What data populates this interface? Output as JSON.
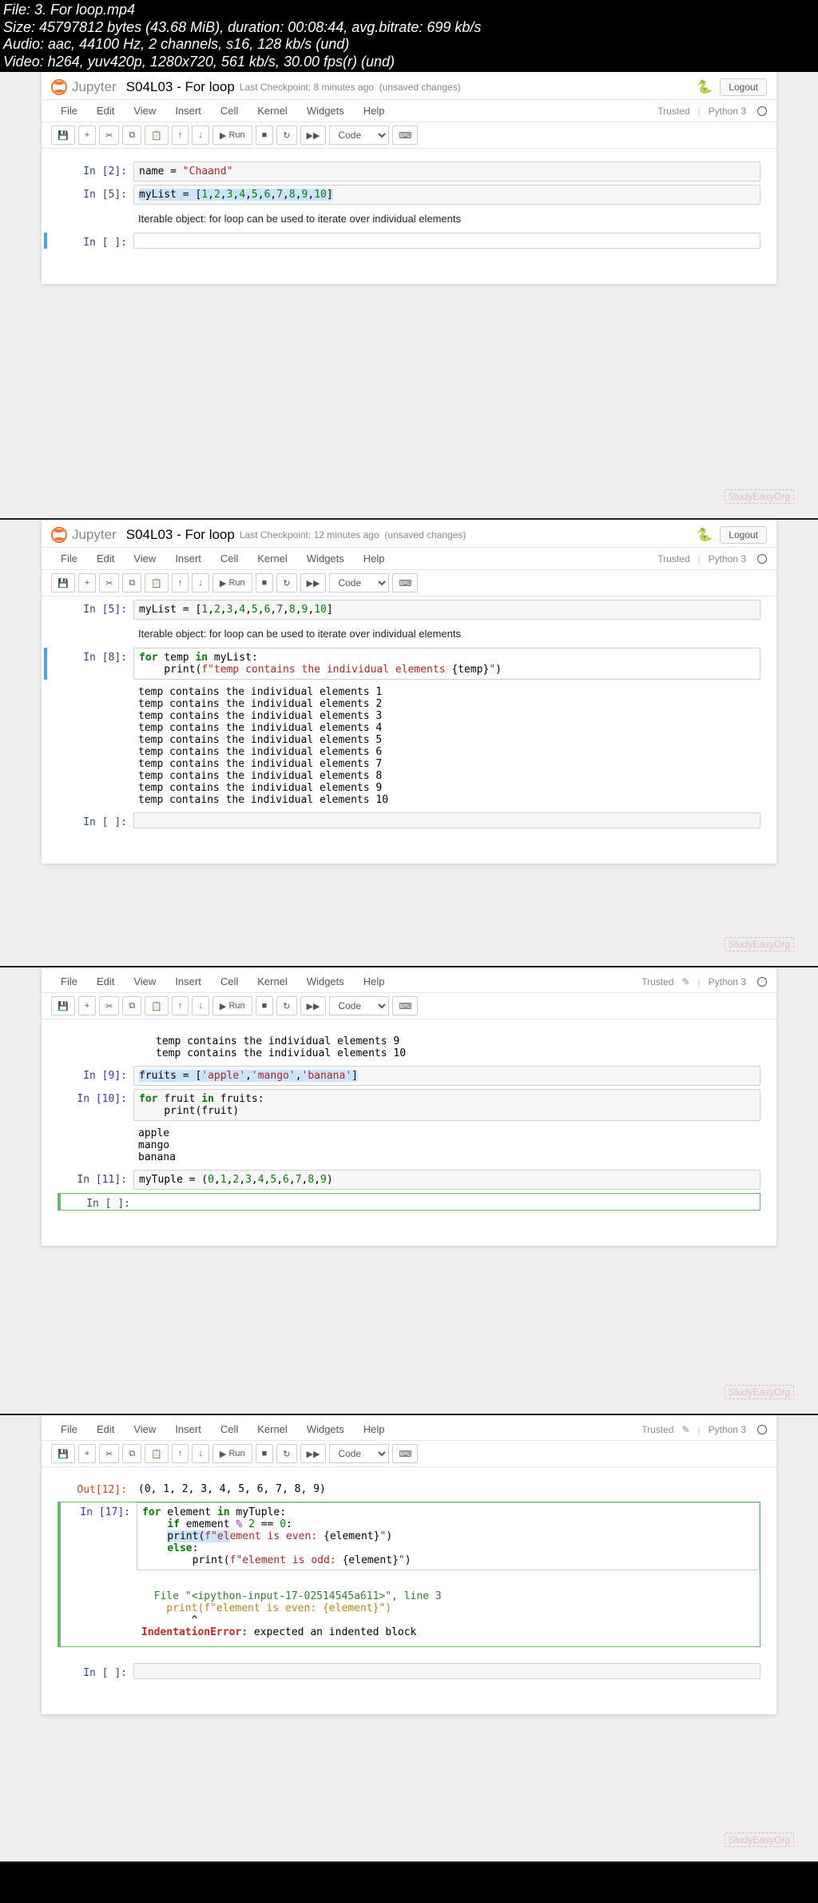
{
  "file_info": {
    "l1": "File: 3. For loop.mp4",
    "l2": "Size: 45797812 bytes (43.68 MiB), duration: 00:08:44, avg.bitrate: 699 kb/s",
    "l3": "Audio: aac, 44100 Hz, 2 channels, s16, 128 kb/s (und)",
    "l4": "Video: h264, yuv420p, 1280x720, 561 kb/s, 30.00 fps(r) (und)"
  },
  "common": {
    "jupyter": "Jupyter",
    "title": "S04L03 - For loop",
    "unsaved": "(unsaved changes)",
    "logout": "Logout",
    "menus": {
      "file": "File",
      "edit": "Edit",
      "view": "View",
      "insert": "Insert",
      "cell": "Cell",
      "kernel": "Kernel",
      "widgets": "Widgets",
      "help": "Help"
    },
    "trusted": "Trusted",
    "kernel": "Python 3",
    "run": "Run",
    "celltype": "Code",
    "save_icon": "💾",
    "add_icon": "+",
    "cut_icon": "✂",
    "copy_icon": "⧉",
    "paste_icon": "📋",
    "up_icon": "↑",
    "down_icon": "↓",
    "play_icon": "▶",
    "stop_icon": "■",
    "restart_icon": "↻",
    "ff_icon": "▶▶",
    "keyboard_icon": "⌨",
    "watermark": "StudyEasyOrg"
  },
  "p1": {
    "checkpoint": "Last Checkpoint: 8 minutes ago",
    "c1": {
      "prompt": "In [2]:",
      "code": "name = \"Chaand\""
    },
    "c2": {
      "prompt": "In [5]:",
      "code": "myList = [1,2,3,4,5,6,7,8,9,10]"
    },
    "txt": "Iterable object: for loop can be used to iterate over individual elements",
    "c3": {
      "prompt": "In [ ]:"
    }
  },
  "p2": {
    "checkpoint": "Last Checkpoint: 12 minutes ago",
    "c1": {
      "prompt": "In [5]:",
      "code": "myList = [1,2,3,4,5,6,7,8,9,10]"
    },
    "txt": "Iterable object: for loop can be used to iterate over individual elements",
    "c2": {
      "prompt": "In [8]:"
    },
    "out": "temp contains the individual elements 1\ntemp contains the individual elements 2\ntemp contains the individual elements 3\ntemp contains the individual elements 4\ntemp contains the individual elements 5\ntemp contains the individual elements 6\ntemp contains the individual elements 7\ntemp contains the individual elements 8\ntemp contains the individual elements 9\ntemp contains the individual elements 10",
    "c3": {
      "prompt": "In [ ]:"
    }
  },
  "p3": {
    "out_tail": "temp contains the individual elements 9\ntemp contains the individual elements 10",
    "c1": {
      "prompt": "In [9]:"
    },
    "c2": {
      "prompt": "In [10]:"
    },
    "out2": "apple\nmango\nbanana",
    "c3": {
      "prompt": "In [11]:"
    },
    "c4": {
      "prompt": "In [ ]:"
    }
  },
  "p4": {
    "out_prompt": "Out[12]:",
    "out_val": "(0, 1, 2, 3, 4, 5, 6, 7, 8, 9)",
    "c1": {
      "prompt": "In [17]:"
    },
    "err_file": "  File \"<ipython-input-17-02514545a611>\", line 3",
    "err_line": "    print(f\"element is even: {element}\")",
    "err_caret": "        ^",
    "err_name": "IndentationError:",
    "err_msg": " expected an indented block",
    "c2": {
      "prompt": "In [ ]:"
    }
  },
  "tc": {
    "p1": "",
    "p2": "",
    "p3": "",
    "p4": ""
  }
}
